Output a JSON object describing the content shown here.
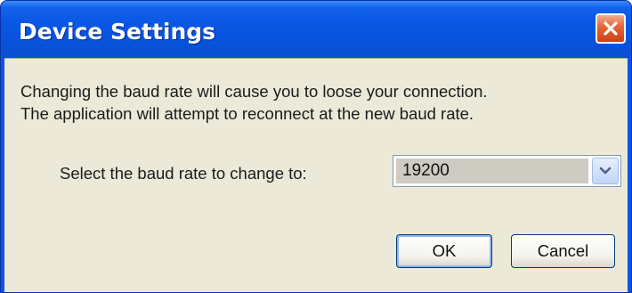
{
  "window": {
    "title": "Device Settings",
    "close_icon": "close-icon"
  },
  "message": {
    "line1": "Changing the baud rate will cause you to loose your connection.",
    "line2": "The application will attempt to reconnect at the new baud rate."
  },
  "baud": {
    "label": "Select the baud rate to change to:",
    "selected": "19200",
    "dropdown_icon": "chevron-down-icon"
  },
  "buttons": {
    "ok": "OK",
    "cancel": "Cancel"
  },
  "colors": {
    "titlebar": "#0a58e5",
    "client": "#ece9d8",
    "close": "#e46a3c"
  }
}
